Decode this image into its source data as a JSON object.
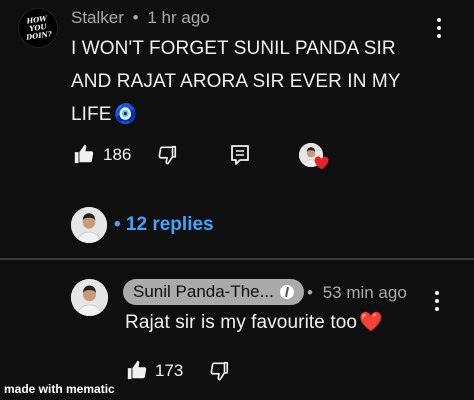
{
  "comment": {
    "avatar_text": "HOW YOU DOIN?",
    "author": "Stalker",
    "separator": "•",
    "time": "1 hr ago",
    "line1": "I WON'T FORGET SUNIL PANDA SIR",
    "line2": "AND RAJAT ARORA SIR EVER IN MY",
    "line3": "LIFE",
    "emoji": "🧿",
    "like_count": "186",
    "replies_label": "• 12 replies"
  },
  "reply": {
    "author": "Sunil Panda-The...",
    "separator": "•",
    "time": "53 min ago",
    "text": "Rajat sir is my favourite too",
    "emoji": "❤️",
    "like_count": "173"
  },
  "watermark": "made with mematic",
  "colors": {
    "background": "#0f0f0f",
    "text": "#f1f1f1",
    "meta": "#aaaaaa",
    "link": "#3ea6ff",
    "heart": "#e8222c"
  }
}
